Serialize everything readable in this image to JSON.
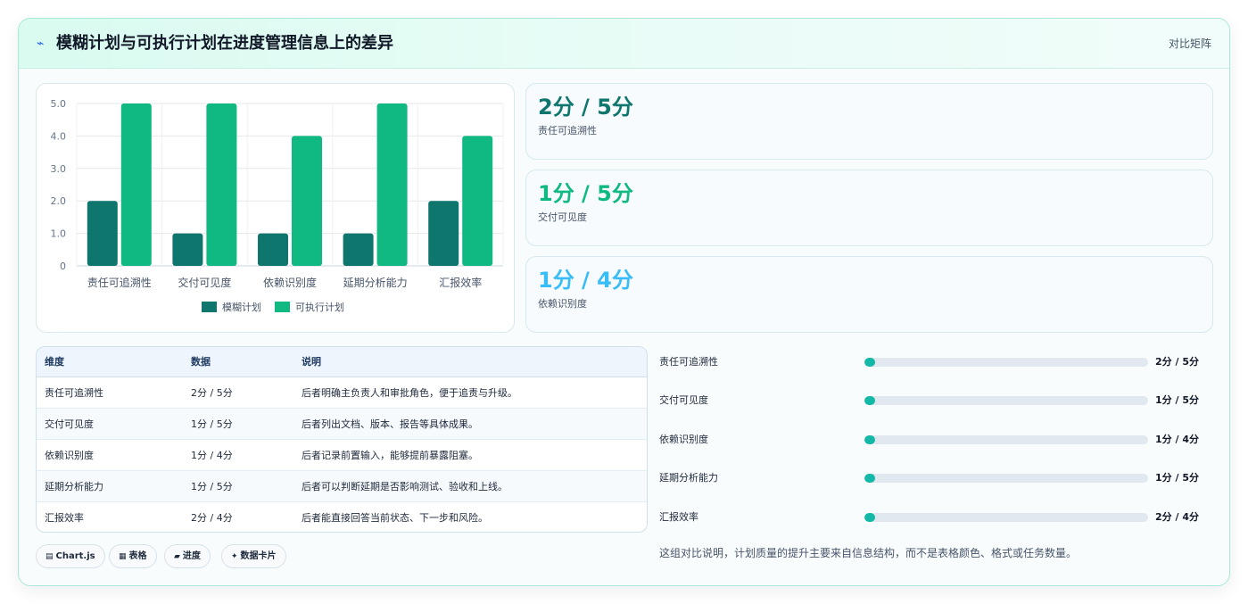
{
  "header": {
    "title": "模糊计划与可执行计划在进度管理信息上的差异",
    "title_icon": "lightning-icon",
    "link": "对比矩阵"
  },
  "colors": {
    "fuzzy": "#0f766e",
    "executable": "#10b981",
    "stat1": "#0f766e",
    "stat2": "#10b981",
    "stat3": "#38bdf8",
    "progress": "#14b8a6"
  },
  "chart_data": {
    "type": "bar",
    "categories": [
      "责任可追溯性",
      "交付可见度",
      "依赖识别度",
      "延期分析能力",
      "汇报效率"
    ],
    "series": [
      {
        "name": "模糊计划",
        "values": [
          2,
          1,
          1,
          1,
          2
        ]
      },
      {
        "name": "可执行计划",
        "values": [
          5,
          5,
          4,
          5,
          4
        ]
      }
    ],
    "ylim": [
      0,
      5
    ],
    "yticks": [
      "0",
      "1.0",
      "2.0",
      "3.0",
      "4.0",
      "5.0"
    ],
    "grid": true,
    "legend": "bottom"
  },
  "stats": [
    {
      "value": "2分 / 5分",
      "label": "责任可追溯性"
    },
    {
      "value": "1分 / 5分",
      "label": "交付可见度"
    },
    {
      "value": "1分 / 4分",
      "label": "依赖识别度"
    }
  ],
  "table": {
    "headers": [
      "维度",
      "数据",
      "说明"
    ],
    "rows": [
      [
        "责任可追溯性",
        "2分 / 5分",
        "后者明确主负责人和审批角色，便于追责与升级。"
      ],
      [
        "交付可见度",
        "1分 / 5分",
        "后者列出文档、版本、报告等具体成果。"
      ],
      [
        "依赖识别度",
        "1分 / 4分",
        "后者记录前置输入，能够提前暴露阻塞。"
      ],
      [
        "延期分析能力",
        "1分 / 5分",
        "后者可以判断延期是否影响测试、验收和上线。"
      ],
      [
        "汇报效率",
        "2分 / 4分",
        "后者能直接回答当前状态、下一步和风险。"
      ]
    ]
  },
  "progress": [
    {
      "label": "责任可追溯性",
      "value": "2分 / 5分",
      "level": 0
    },
    {
      "label": "交付可见度",
      "value": "1分 / 5分",
      "level": 0
    },
    {
      "label": "依赖识别度",
      "value": "1分 / 4分",
      "level": 0
    },
    {
      "label": "延期分析能力",
      "value": "1分 / 5分",
      "level": 0
    },
    {
      "label": "汇报效率",
      "value": "2分 / 4分",
      "level": 0
    }
  ],
  "note": "这组对比说明，计划质量的提升主要来自信息结构，而不是表格颜色、格式或任务数量。",
  "pills": [
    {
      "icon": "chart-icon",
      "glyph": "▤",
      "label": "Chart.js"
    },
    {
      "icon": "table-icon",
      "glyph": "▦",
      "label": "表格"
    },
    {
      "icon": "progress-icon",
      "glyph": "▰",
      "label": "进度"
    },
    {
      "icon": "sparkle-icon",
      "glyph": "✦",
      "label": "数据卡片"
    }
  ]
}
